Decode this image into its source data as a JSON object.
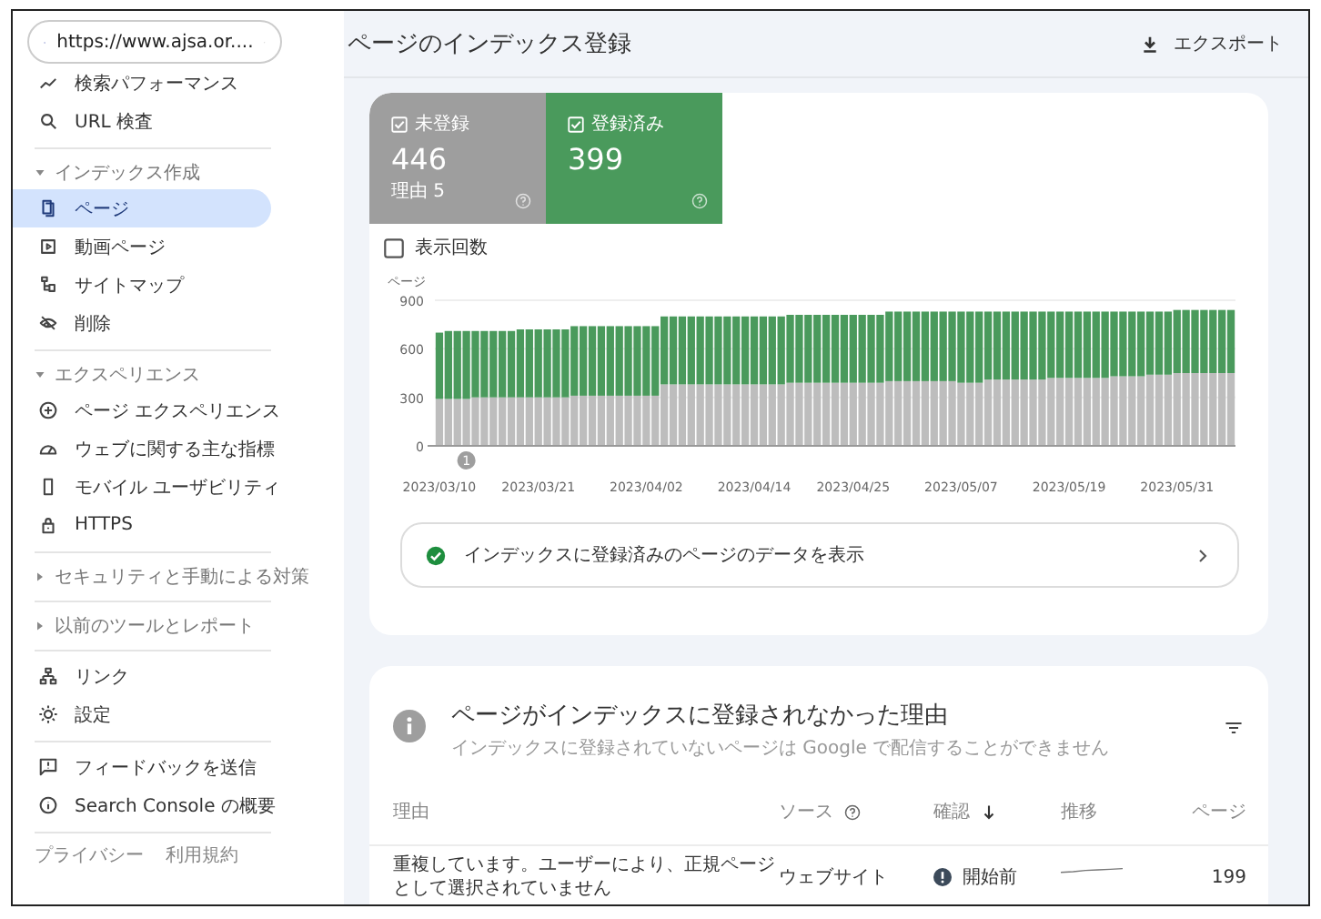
{
  "sidebar": {
    "property": {
      "label": "https://www.ajsa.or...."
    },
    "groups": [
      {
        "items": [
          {
            "label": "検索パフォーマンス",
            "selected": false
          },
          {
            "label": "URL 検査",
            "selected": false
          }
        ]
      },
      {
        "header": {
          "label": "インデックス作成",
          "expanded": true
        },
        "items": [
          {
            "label": "ページ",
            "selected": true
          },
          {
            "label": "動画ページ",
            "selected": false
          },
          {
            "label": "サイトマップ",
            "selected": false
          },
          {
            "label": "削除",
            "selected": false
          }
        ]
      },
      {
        "header": {
          "label": "エクスペリエンス",
          "expanded": true
        },
        "items": [
          {
            "label": "ページ エクスペリエンス",
            "selected": false
          },
          {
            "label": "ウェブに関する主な指標",
            "selected": false
          },
          {
            "label": "モバイル ユーザビリティ",
            "selected": false
          },
          {
            "label": "HTTPS",
            "selected": false
          }
        ]
      },
      {
        "header": {
          "label": "セキュリティと手動による対策",
          "expanded": false
        }
      },
      {
        "header": {
          "label": "以前のツールとレポート",
          "expanded": false
        }
      },
      {
        "items": [
          {
            "label": "リンク",
            "selected": false
          },
          {
            "label": "設定",
            "selected": false
          }
        ]
      },
      {
        "items": [
          {
            "label": "フィードバックを送信",
            "selected": false
          },
          {
            "label": "Search Console の概要",
            "selected": false
          }
        ]
      }
    ],
    "footer_links": [
      "プライバシー",
      "利用規約"
    ]
  },
  "header": {
    "title": "ページのインデックス登録",
    "export": "エクスポート"
  },
  "summary": {
    "tiles": [
      {
        "label": "未登録",
        "value": "446",
        "sub": "理由 5",
        "checked": true,
        "color": "#9e9e9e"
      },
      {
        "label": "登録済み",
        "value": "399",
        "checked": true,
        "color": "#4a9a5c"
      }
    ],
    "impressions": {
      "label": "表示回数",
      "checked": false
    },
    "chart_data": {
      "type": "bar",
      "stacked": true,
      "ylabel": "ページ",
      "yticks": [
        0,
        300,
        600,
        900
      ],
      "ylim": [
        0,
        900
      ],
      "categories": [
        "2023/03/10",
        null,
        null,
        null,
        null,
        null,
        null,
        null,
        null,
        null,
        null,
        "2023/03/21",
        null,
        null,
        null,
        null,
        null,
        null,
        null,
        null,
        null,
        null,
        null,
        "2023/04/02",
        null,
        null,
        null,
        null,
        null,
        null,
        null,
        null,
        null,
        null,
        null,
        "2023/04/14",
        null,
        null,
        null,
        null,
        null,
        null,
        null,
        null,
        null,
        null,
        "2023/04/25",
        null,
        null,
        null,
        null,
        null,
        null,
        null,
        null,
        null,
        null,
        null,
        "2023/05/07",
        null,
        null,
        null,
        null,
        null,
        null,
        null,
        null,
        null,
        null,
        null,
        "2023/05/19",
        null,
        null,
        null,
        null,
        null,
        null,
        null,
        null,
        null,
        null,
        null,
        "2023/05/31",
        null,
        null,
        null,
        null,
        null,
        null
      ],
      "series": [
        {
          "color": "#bdbdbd",
          "values": [
            290,
            290,
            290,
            290,
            300,
            300,
            300,
            300,
            300,
            300,
            300,
            300,
            300,
            300,
            300,
            310,
            310,
            310,
            310,
            310,
            310,
            310,
            310,
            310,
            310,
            380,
            380,
            380,
            380,
            380,
            380,
            380,
            380,
            380,
            380,
            380,
            380,
            380,
            380,
            390,
            390,
            390,
            390,
            390,
            390,
            390,
            390,
            390,
            390,
            390,
            400,
            400,
            400,
            400,
            400,
            400,
            400,
            400,
            390,
            390,
            390,
            410,
            410,
            410,
            410,
            410,
            410,
            410,
            420,
            420,
            420,
            420,
            420,
            420,
            420,
            430,
            430,
            430,
            430,
            440,
            440,
            440,
            450,
            450,
            450,
            450,
            450,
            450,
            450
          ]
        },
        {
          "color": "#4a9a5c",
          "values": [
            410,
            420,
            420,
            420,
            410,
            410,
            410,
            410,
            410,
            420,
            420,
            420,
            420,
            420,
            420,
            430,
            430,
            430,
            430,
            430,
            430,
            430,
            430,
            430,
            430,
            420,
            420,
            420,
            420,
            420,
            420,
            420,
            420,
            420,
            420,
            420,
            420,
            420,
            420,
            420,
            420,
            420,
            420,
            420,
            420,
            420,
            420,
            420,
            420,
            420,
            430,
            430,
            430,
            430,
            430,
            430,
            430,
            430,
            440,
            440,
            440,
            420,
            420,
            420,
            420,
            420,
            420,
            420,
            410,
            410,
            410,
            410,
            410,
            410,
            410,
            400,
            400,
            400,
            400,
            390,
            390,
            390,
            390,
            390,
            390,
            390,
            390,
            390,
            390
          ]
        }
      ],
      "annotations": [
        {
          "text": "1"
        }
      ]
    },
    "link": "インデックスに登録済みのページのデータを表示"
  },
  "reasons": {
    "title": "ページがインデックスに登録されなかった理由",
    "subtitle": "インデックスに登録されていないページは Google で配信することができません",
    "columns": [
      {
        "label": "理由",
        "kind": "plain"
      },
      {
        "label": "ソース",
        "kind": "help"
      },
      {
        "label": "確認",
        "kind": "sorted"
      },
      {
        "label": "推移",
        "kind": "plain"
      },
      {
        "label": "ページ",
        "kind": "plain"
      }
    ],
    "rows": [
      {
        "reason": "重複しています。ユーザーにより、正規ページとして選択されていません",
        "source": "ウェブサイト",
        "validation": "開始前",
        "pages": "199"
      }
    ]
  }
}
